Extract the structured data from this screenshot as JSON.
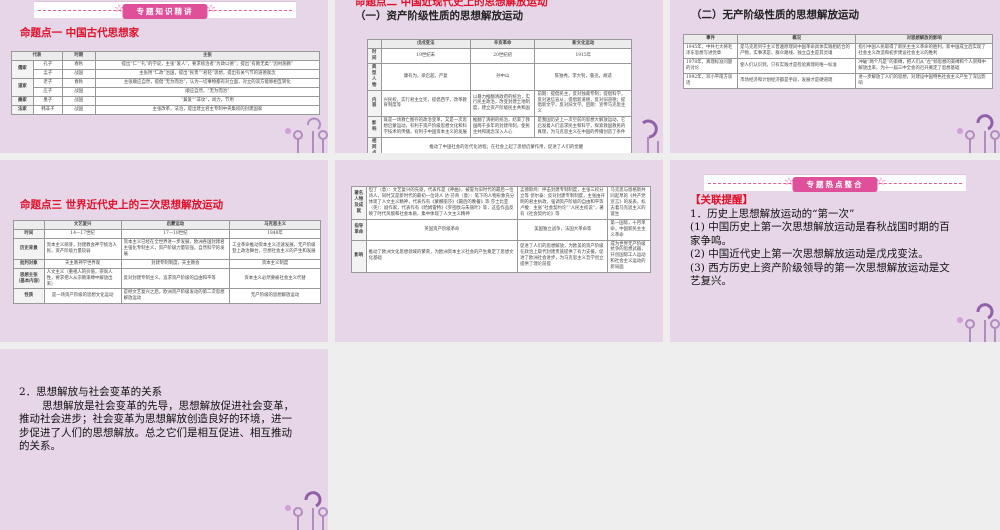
{
  "slide1": {
    "banner": "专题知识精讲",
    "title": "命题点一  中国古代思想家",
    "headers": [
      "代表",
      "时期",
      "主张"
    ],
    "rows": [
      {
        "school": "儒家",
        "span": 2,
        "person": "孔子",
        "period": "春秋",
        "claim": "提出“仁”“礼”的学说，主张“爱人”，要求统治者“为政以德”；提出“有教无类”“因材施教”"
      },
      {
        "person": "孟子",
        "period": "战国",
        "claim": "主张用“仁政”治国，提出“民贵”“君轻”思想，提出有关气节的道德观念"
      },
      {
        "school": "道家",
        "span": 2,
        "person": "老子",
        "period": "春秋",
        "claim": "主张顺应自然，提倡“无为而治”，认为一切事物都有对立面，对立的双方能够相互转化"
      },
      {
        "person": "庄子",
        "period": "战国",
        "claim": "顺应自然，“无为而治”"
      },
      {
        "school": "墨家",
        "span": 1,
        "person": "墨子",
        "period": "战国",
        "claim": "“兼爱”“非攻”，尚力，节用"
      },
      {
        "school": "法家",
        "span": 1,
        "person": "韩非子",
        "period": "战国",
        "claim": "主张改革，法治，提出建立君主专制中央集权的封建国家"
      }
    ]
  },
  "slide2": {
    "title": "命题点二  中国近现代史上的思想解放运动",
    "subtitle": "（一）资产阶级性质的思想解放运动",
    "headers": [
      "",
      "戊戌变法",
      "辛亥革命",
      "新文化运动"
    ],
    "rows": [
      [
        "时间",
        "19世纪末",
        "20世纪初",
        "1915年"
      ],
      [
        "典型人物",
        "康有为，梁启超，严复",
        "孙中山",
        "陈独秀，李大钊，鲁迅，胡适"
      ],
      [
        "内容",
        "兴民权，实行君主立宪，提倡西学，改革教育制度等",
        "以暴力推翻清政府的统治，实行民主政治，改变封建土地制度，建立资产阶级民主共和国",
        "前期：提倡民主，反对独裁专制；提倡科学，反对迷信盲从；提倡新道德，反对旧道德；提倡新文学，反对旧文学。后期：宣传马克思主义"
      ],
      [
        "影响",
        "既是一场救亡图存的政治变革，又是一次思想启蒙运动，有利于资产阶级思想文化和科学技术的传播，有利于中国资本主义的发展",
        "推翻了清朝的统治，结束了我国两千多年的封建帝制，使民主共和观念深入人心",
        "是我国历史上一次空前的思想大解放运动，它启发着人们追求民主和科学，探索救国救民的真理，为马克思主义在中国的传播创造了条件"
      ]
    ],
    "common_label": "相同点",
    "common": "推动了中国社会的近代化进程；在社会上起了思想启蒙作用，促进了人们的觉醒"
  },
  "slide3": {
    "subtitle": "（二）无产阶级性质的思想解放运动",
    "headers": [
      "事件",
      "概况",
      "对思想解放的影响"
    ],
    "rows": [
      [
        "1945年，中共七大将毛泽东思想写进党章",
        "是马克思列宁主义普遍原理同中国革命具体实践相结合的产物，实事求是、群众路线、独立自主是其灵魂",
        "指引中国人民取得了新民主主义革命的胜利，新中国成立后实现了社会主义改造和初步建设社会主义的胜利"
      ],
      [
        "1978年，真理标准问题的讨论",
        "使人们认识到，只有实践才是检验真理的唯一标准",
        "冲破“两个凡是”的束缚，把人们从“左”倾思想的束缚和个人崇拜中解放出来，为十一届三中全会的召开奠定了思想基础"
      ],
      [
        "1992年，邓小平南方谈话",
        "市场经济和计划经济都是手段，发展才是硬道理",
        "进一步解放了人们的思想，对建设中国特色社会主义产生了深远影响"
      ]
    ]
  },
  "slide4": {
    "title": "命题点三  世界近代史上的三次思想解放运动",
    "headers": [
      "",
      "文艺复兴",
      "启蒙运动",
      "马克思主义"
    ],
    "rows": [
      [
        "时间",
        "14—17世纪",
        "17—18世纪",
        "1848年"
      ],
      [
        "历史背景",
        "资本主义萌芽，封建教会神学统治人民，资产阶级力量较弱",
        "资本主义已经在全世界进一步发展，欧洲各国封建君主强化专制主义，资产阶级力量较强，自然科学的发展",
        "工业革命推动资本主义迅速发展，无产阶级登上政治舞台，空想社会主义的产生和发展"
      ],
      [
        "批判对象",
        "天主教神学世界观",
        "封建专制制度，天主教会",
        "资本主义制度"
      ],
      [
        "思想主张（基本内容）",
        "人文主义（重视人的价值，崇尚人性，要求把人从宗教束缚中解放出来）",
        "反对封建专制主义，追求资产阶级的自由和平等",
        "资本主义必然要被社会主义代替"
      ],
      [
        "性质",
        "是一场资产阶级的思想文化运动",
        "是继文艺复兴之后，欧洲资产阶级发动的第二次思想解放运动",
        "无产阶级的思想解放运动"
      ]
    ]
  },
  "slide5": {
    "rows": [
      [
        "著名人物及成就",
        "但丁（意）：文艺复兴的先驱，代表作是《神曲》，被誉为旧时代的最后一位诗人，同时又是新时代的最初一位诗人 达·芬奇（意）：笔下的人物形象充分体现了人文主义精神，代表作有《蒙娜丽莎》《最后的晚餐》等 莎士比亚（英）：剧作家，代表作有《哈姆雷特》《罗密欧与朱丽叶》等，这些作品反映了时代风貌和社会本质，集中体现了人文主义精神",
        "孟德斯鸠：抨击封建专制制度，主张三权分立等 伏尔泰：反对封建专制制度，主张由开明的君主执政，强调资产阶级的自由和平等 卢梭：主张“社会契约论”“人民主权说”，著有《社会契约论》等",
        "马克思与恩格斯共同起草的《共产党宣言》的发表，标志着马克思主义的诞生"
      ],
      [
        "指导革命",
        "英国资产阶级革命",
        "美国独立战争，法国大革命等",
        "第一国际，十月革命，中国新民主主义革命"
      ],
      [
        "影响",
        "推动了欧洲文化思想领域的繁荣，为欧洲资本主义社会的产生奠定了思想文化基础",
        "促进了人们的思想解放，为欧美的资产阶级在政治上取代封建贵族提供了有力支援，促进了欧洲社会进步，为马克思主义哲学创立提供了理论前提",
        "成为世界无产阶级抗争的思想武器，开创国际工人运动和社会主义运动的新局面"
      ]
    ]
  },
  "slide6": {
    "banner": "专题热点整合",
    "tag": "【关联提醒】",
    "lines": [
      "1．历史上思想解放运动的“第一次”",
      "(1) 中国历史上第一次思想解放运动是春秋战国时期的百家争鸣。",
      "(2) 中国近代史上第一次思想解放运动是戊戌变法。",
      "(3) 西方历史上资产阶级领导的第一次思想解放运动是文艺复兴。"
    ]
  },
  "slide7": {
    "heading": "2．思想解放与社会变革的关系",
    "paragraph": "思想解放是社会变革的先导，思想解放促进社会变革，推动社会进步；社会变革为思想解放创造良好的环境，进一步促进了人们的思想解放。总之它们是相互促进、相互推动的关系。"
  },
  "colors": {
    "slide_bg": "#e7d6e8",
    "accent_red": "#e0102a",
    "banner_pink": "#e0509a"
  }
}
